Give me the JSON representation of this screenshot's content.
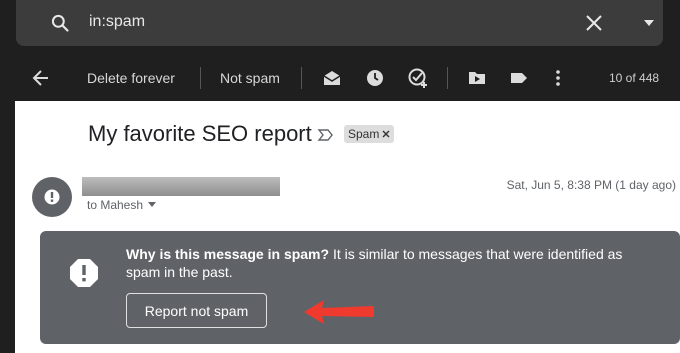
{
  "search": {
    "query": "in:spam"
  },
  "toolbar": {
    "delete_forever": "Delete forever",
    "not_spam": "Not spam",
    "pagination": "10 of 448"
  },
  "email": {
    "subject": "My favorite SEO report",
    "label": "Spam",
    "to": "to Mahesh",
    "date": "Sat, Jun 5, 8:38 PM (1 day ago)"
  },
  "spam_notice": {
    "heading": "Why is this message in spam?",
    "body": " It is similar to messages that were identified as spam in the past.",
    "button": "Report not spam"
  },
  "colors": {
    "arrow": "#f03a2e",
    "notice_bg": "#5f6368",
    "toolbar_bg": "#1f1f1f"
  }
}
